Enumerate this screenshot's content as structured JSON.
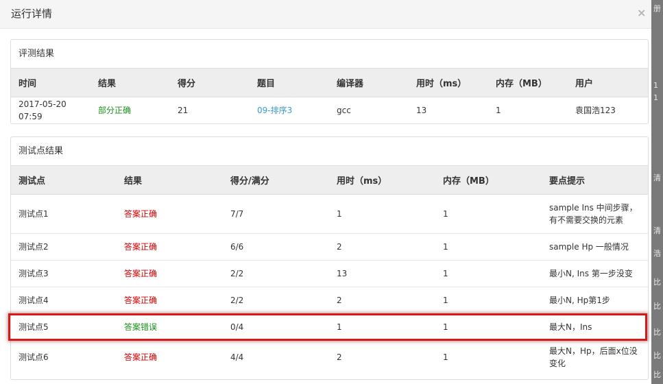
{
  "modal": {
    "title": "运行详情",
    "close_label": "×"
  },
  "judge_panel": {
    "heading": "评测结果",
    "columns": [
      "时间",
      "结果",
      "得分",
      "题目",
      "编译器",
      "用时（ms）",
      "内存（MB）",
      "用户"
    ],
    "row": {
      "time": "2017-05-20 07:59",
      "result": "部分正确",
      "score": "21",
      "problem": "09-排序3",
      "compiler": "gcc",
      "time_ms": "13",
      "memory_mb": "1",
      "user": "袁国浩123"
    }
  },
  "testcase_panel": {
    "heading": "测试点结果",
    "columns": [
      "测试点",
      "结果",
      "得分/满分",
      "用时（ms）",
      "内存（MB）",
      "要点提示"
    ],
    "rows": [
      {
        "case": "测试点1",
        "result": "答案正确",
        "score": "7/7",
        "time_ms": "1",
        "memory_mb": "1",
        "hint": "sample Ins 中间步骤，有不需要交换的元素"
      },
      {
        "case": "测试点2",
        "result": "答案正确",
        "score": "6/6",
        "time_ms": "2",
        "memory_mb": "1",
        "hint": "sample Hp 一般情况"
      },
      {
        "case": "测试点3",
        "result": "答案正确",
        "score": "2/2",
        "time_ms": "13",
        "memory_mb": "1",
        "hint": "最小N, Ins 第一步没变"
      },
      {
        "case": "测试点4",
        "result": "答案正确",
        "score": "2/2",
        "time_ms": "2",
        "memory_mb": "1",
        "hint": "最小N, Hp第1步"
      },
      {
        "case": "测试点5",
        "result": "答案错误",
        "score": "0/4",
        "time_ms": "1",
        "memory_mb": "1",
        "hint": "最大N，Ins"
      },
      {
        "case": "测试点6",
        "result": "答案正确",
        "score": "4/4",
        "time_ms": "2",
        "memory_mb": "1",
        "hint": "最大N，Hp，后面x位没变化"
      }
    ]
  },
  "background_strip": {
    "chars": [
      "册",
      "1",
      "1",
      "清",
      "清",
      "浩",
      "比",
      "比",
      "比",
      "比",
      "比"
    ]
  },
  "colors": {
    "ok_green": "#1a8f1a",
    "error_red": "#cc0000",
    "link_blue": "#3a9ad9",
    "highlight_red": "#d11a1a"
  }
}
